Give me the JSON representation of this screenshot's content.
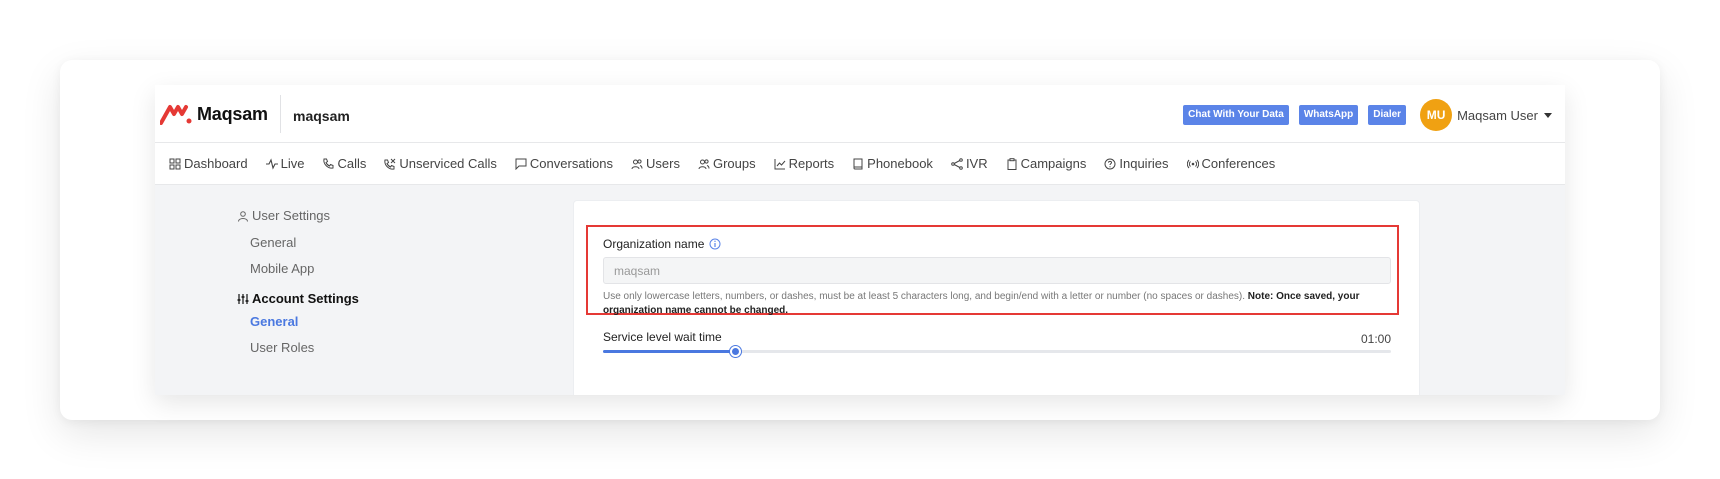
{
  "app": {
    "logo_text": "Maqsam",
    "org_name": "maqsam",
    "brand_color": "#e53935",
    "accent_color": "#4a78e0"
  },
  "header": {
    "buttons": [
      {
        "label": "Chat With Your Data"
      },
      {
        "label": "WhatsApp"
      },
      {
        "label": "Dialer"
      }
    ],
    "user": {
      "initials": "MU",
      "name": "Maqsam User",
      "avatar_color": "#f0a112"
    }
  },
  "nav": {
    "items": [
      {
        "label": "Dashboard",
        "icon": "grid-icon"
      },
      {
        "label": "Live",
        "icon": "activity-icon"
      },
      {
        "label": "Calls",
        "icon": "phone-icon"
      },
      {
        "label": "Unserviced Calls",
        "icon": "phone-missed-icon"
      },
      {
        "label": "Conversations",
        "icon": "message-icon"
      },
      {
        "label": "Users",
        "icon": "users-icon"
      },
      {
        "label": "Groups",
        "icon": "users-icon"
      },
      {
        "label": "Reports",
        "icon": "chart-line-icon"
      },
      {
        "label": "Phonebook",
        "icon": "book-icon"
      },
      {
        "label": "IVR",
        "icon": "share-icon"
      },
      {
        "label": "Campaigns",
        "icon": "clipboard-icon"
      },
      {
        "label": "Inquiries",
        "icon": "help-circle-icon"
      },
      {
        "label": "Conferences",
        "icon": "broadcast-icon"
      }
    ]
  },
  "sidebar": {
    "user_settings": {
      "title": "User Settings",
      "items": [
        {
          "label": "General"
        },
        {
          "label": "Mobile App"
        }
      ]
    },
    "account_settings": {
      "title": "Account Settings",
      "items": [
        {
          "label": "General",
          "active": true
        },
        {
          "label": "User Roles"
        }
      ]
    }
  },
  "form": {
    "org_name_label": "Organization name",
    "org_name_value": "maqsam",
    "help_text": "Use only lowercase letters, numbers, or dashes, must be at least 5 characters long, and begin/end with a letter or number (no spaces or dashes).",
    "help_note": "Note: Once saved, your organization name cannot be changed.",
    "service_level_label": "Service level wait time",
    "service_level_value": "01:00",
    "service_level_fraction": 0.167
  }
}
